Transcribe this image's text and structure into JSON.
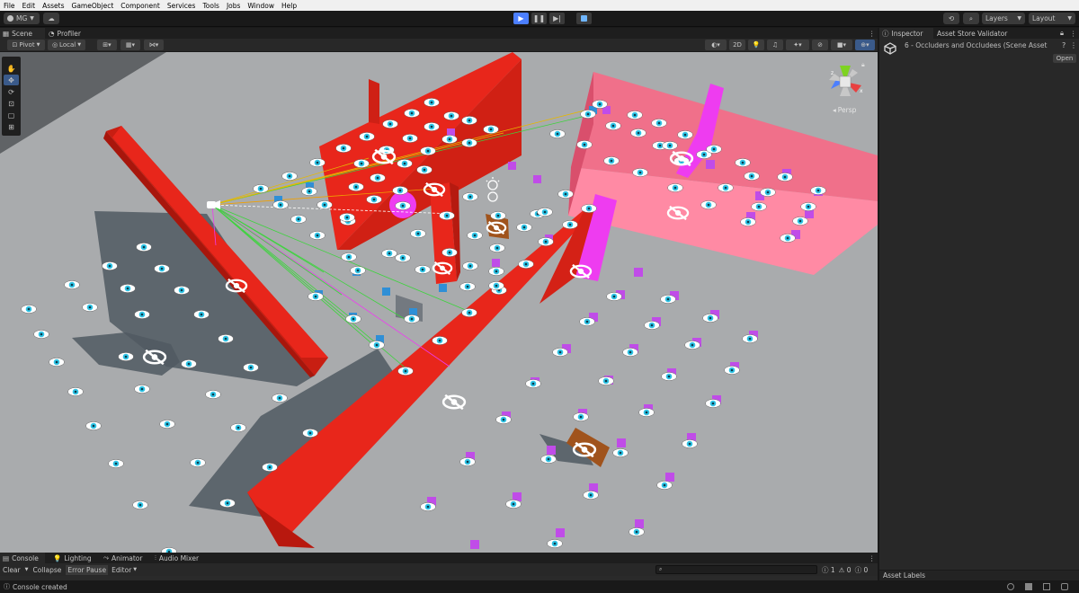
{
  "menu": [
    "File",
    "Edit",
    "Assets",
    "GameObject",
    "Component",
    "Services",
    "Tools",
    "Jobs",
    "Window",
    "Help"
  ],
  "toolbar": {
    "account_label": "MG",
    "cloud_icon": "cloud-icon",
    "layers_label": "Layers",
    "layout_label": "Layout",
    "accent": "#4c7fff"
  },
  "scene_tabs": {
    "scene": "Scene",
    "profiler": "Profiler"
  },
  "scene_toolbar": {
    "pivot": "Pivot",
    "local": "Local",
    "mode_2d": "2D"
  },
  "viewport": {
    "persp_label": "Persp",
    "colors": {
      "ground": "#a9abad",
      "red_wall": "#e8261b",
      "pink_wall": "#f0708a",
      "magenta": "#ee3cf0",
      "eye": "#2fc4e6"
    }
  },
  "inspector": {
    "tab_inspector": "Inspector",
    "tab_validator": "Asset Store Validator",
    "asset_title": "6 - Occluders and Occludees (Scene Asset",
    "open_button": "Open",
    "asset_labels": "Asset Labels"
  },
  "bottom": {
    "tabs": [
      "Console",
      "Lighting",
      "Animator",
      "Audio Mixer"
    ],
    "clear": "Clear",
    "collapse": "Collapse",
    "error_pause": "Error Pause",
    "editor": "Editor",
    "counts": {
      "info": "1",
      "warning": "0",
      "error": "0"
    }
  },
  "status": {
    "message": "Console created"
  }
}
